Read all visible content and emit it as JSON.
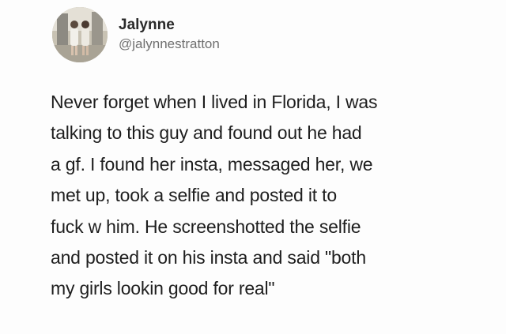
{
  "author": {
    "display_name": "Jalynne",
    "handle": "@jalynnestratton",
    "avatar_icon": "profile-photo"
  },
  "tweet": {
    "lines": [
      "Never forget when I lived in Florida, I was",
      "talking to this guy and found out he had",
      "a gf. I found her insta, messaged her, we",
      "met up, took a selfie and posted it to",
      "fuck w him. He screenshotted the selfie",
      "and posted it on his insta and said \"both",
      "my girls lookin good for real\""
    ]
  },
  "colors": {
    "background": "#fdfdfd",
    "text": "#1e1e1e",
    "handle": "#6f6f6f"
  }
}
